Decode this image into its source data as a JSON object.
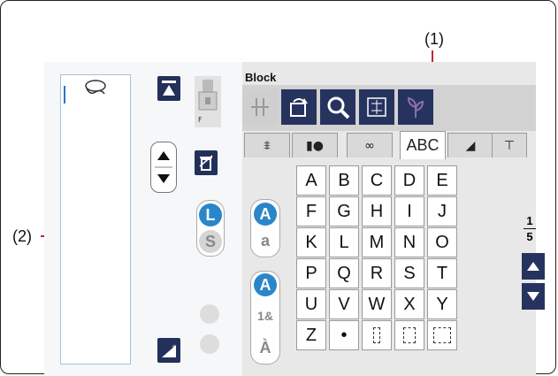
{
  "callouts": {
    "label_1": "(1)",
    "label_2": "(2)"
  },
  "panel": {
    "title": "Block"
  },
  "page": {
    "current": "1",
    "total": "5"
  },
  "mode_toggle": {
    "long_label": "L",
    "short_label": "S"
  },
  "case_toggle": {
    "upper_label": "A",
    "lower_label": "a"
  },
  "charset_toggle": {
    "alpha_label": "A",
    "numsym_label": "1&",
    "accent_label": "À"
  },
  "tabs": [
    {
      "label": "",
      "icon": "stitch-icon"
    },
    {
      "label": "",
      "icon": "satin-icon"
    },
    {
      "label": "",
      "icon": "decorative-icon"
    },
    {
      "label": "ABC",
      "icon": ""
    },
    {
      "label": "",
      "icon": "applique-icon"
    },
    {
      "label": "",
      "icon": "tshirt-icon"
    }
  ],
  "keys": [
    [
      "A",
      "B",
      "C",
      "D",
      "E"
    ],
    [
      "F",
      "G",
      "H",
      "I",
      "J"
    ],
    [
      "K",
      "L",
      "M",
      "N",
      "O"
    ],
    [
      "P",
      "Q",
      "R",
      "S",
      "T"
    ],
    [
      "U",
      "V",
      "W",
      "X",
      "Y"
    ],
    [
      "Z",
      "•",
      "",
      "",
      ""
    ]
  ],
  "colors": {
    "accent_dark": "#27335f",
    "callout_line": "#c0282d",
    "toggle_blue": "#2a86c9"
  }
}
